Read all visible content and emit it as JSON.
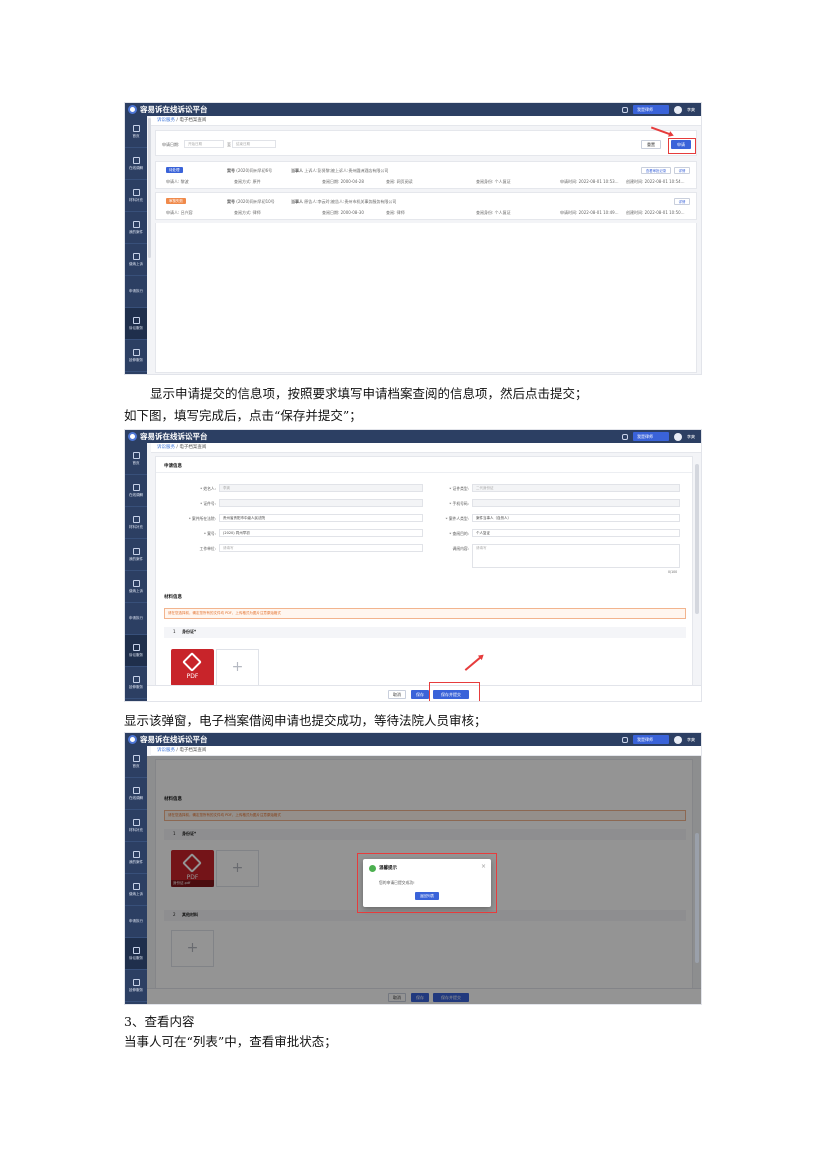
{
  "app": {
    "title": "容易诉在线诉讼平台",
    "role": "我是律师",
    "user": "李爽",
    "breadcrumb_home": "诉讼服务",
    "breadcrumb_page": "电子档案查阅"
  },
  "sidebar": [
    {
      "label": "首页"
    },
    {
      "label": "在线调解"
    },
    {
      "label": "材料补充"
    },
    {
      "label": "我的案件"
    },
    {
      "label": "缴纳上诉"
    },
    {
      "label": "申请执行"
    },
    {
      "label": "诉讼服务"
    },
    {
      "label": "延伸服务"
    }
  ],
  "screen1": {
    "filter_label": "申请日期:",
    "date_start": "开始日期",
    "date_sep": "至",
    "date_end": "结束日期",
    "reset": "重置",
    "apply": "申请",
    "cards": [
      {
        "tag": "待处理",
        "tag_color": "#3a63d9",
        "case_label": "案号",
        "case_no": "(2020)同州早初6号",
        "party_label": "当事人",
        "party": "上诉人:彭贤黎;被上诉人:贵州圆洲酒店有限公司",
        "applicant": "申请人: 黎波",
        "view_mode": "查阅方式: 原件",
        "date": "查阅日期: 2000-04-28",
        "purpose": "查阅: 网页阅读",
        "type": "查阅身份: 个人复证",
        "apply_time": "申请时间: 2022-08-01 10:53...",
        "create_time": "创建时间: 2022-08-01 10:54...",
        "btn1": "查看审批记录",
        "btn2": "详情"
      },
      {
        "tag": "审核失败",
        "tag_color": "#f08a4b",
        "case_label": "案号",
        "case_no": "(2020)同州早初10号",
        "party_label": "当事人",
        "party": "原告人:李云玲;被告人:贵州市机关事务服务有限公司",
        "applicant": "申请人: 吕兴容",
        "view_mode": "查阅方式: 律师",
        "date": "查阅日期: 2000-08-30",
        "purpose": "查阅: 律师",
        "type": "查阅身份: 个人复证",
        "apply_time": "申请时间: 2022-08-01 10:49...",
        "create_time": "创建时间: 2022-08-01 10:50...",
        "btn1": "",
        "btn2": "详情"
      }
    ]
  },
  "para1": "显示申请提交的信息项，按照要求填写申请档案查阅的信息项，然后点击提交；",
  "para2": "如下图，填写完成后，点击“保存并提交”；",
  "screen2": {
    "section_apply": "申请信息",
    "fields_left": [
      {
        "label": "* 姓名人:",
        "value": "李爽"
      },
      {
        "label": "* 证件号:",
        "value": ""
      },
      {
        "label": "* 案件所在法院:",
        "value": "贵州省贵阳市中级人民法院"
      },
      {
        "label": "* 案号:",
        "value": "(2020) 同州早初"
      },
      {
        "label": "工作单位:",
        "value": "请填写"
      }
    ],
    "fields_right": [
      {
        "label": "* 证件类型:",
        "value": "二代身份证"
      },
      {
        "label": "* 手机号码:",
        "value": ""
      },
      {
        "label": "* 案件人类型:",
        "value": "案件当事人（自然人）"
      },
      {
        "label": "* 查阅目的:",
        "value": "个人复证"
      },
      {
        "label": "调阅内容:",
        "value": "请填写"
      }
    ],
    "counter": "0/100",
    "section_material": "材料信息",
    "warning": "请在您选择前，确定您所有的文件均 PDF，上传格式为图片注意原始格式",
    "item1_index": "1",
    "item1_label": "身份证*",
    "pdf_text": "PDF",
    "pdf_caption": "身份证.pdf",
    "cancel": "取消",
    "save": "保存",
    "save_submit": "保存并提交"
  },
  "para3": "显示该弹窗，电子档案借阅申请也提交成功，等待法院人员审核；",
  "screen3": {
    "item2_index": "2",
    "item2_label": "其他材料",
    "modal_title": "温馨提示",
    "modal_body": "您的申请已提交成功!",
    "modal_button": "返回列表",
    "close": "×"
  },
  "heading3": "3、查看内容",
  "para4": "当事人可在“列表”中，查看审批状态；"
}
